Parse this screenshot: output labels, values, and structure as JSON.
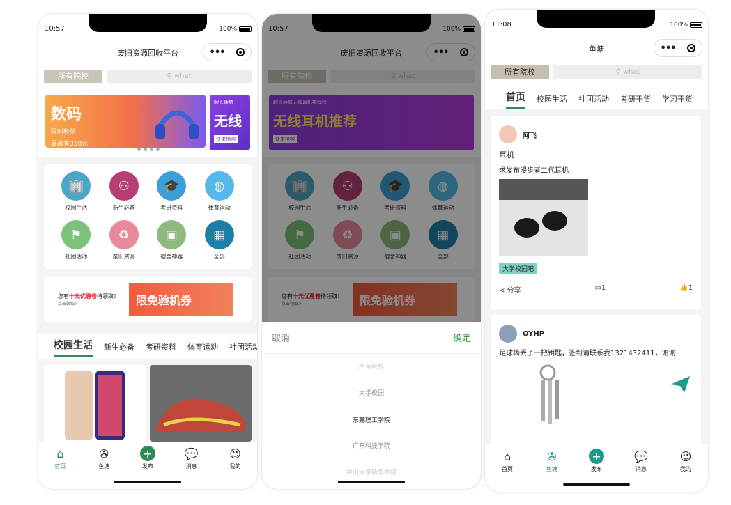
{
  "screen1": {
    "time": "10:57",
    "battery": "100%",
    "title": "废旧资源回收平台",
    "school_btn": "所有院校",
    "search_placeholder": "what",
    "banner_a_big": "数码",
    "banner_a_tag": "限时秒杀",
    "banner_a_small": "最高省350元",
    "banner_b_tiny": "超长续航",
    "banner_b_big": "无线",
    "banner_b_btn": "快来抢购",
    "categories": [
      {
        "label": "校园生活",
        "icon": "building-icon",
        "color": "#4aa7c7"
      },
      {
        "label": "新生必备",
        "icon": "people-icon",
        "color": "#b53e72"
      },
      {
        "label": "考研资料",
        "icon": "graduation-cap-icon",
        "color": "#3b9ed6"
      },
      {
        "label": "体育运动",
        "icon": "basketball-icon",
        "color": "#55b8e8"
      },
      {
        "label": "社团活动",
        "icon": "flag-icon",
        "color": "#7dc27a"
      },
      {
        "label": "废旧资源",
        "icon": "recycle-box-icon",
        "color": "#e88a9c"
      },
      {
        "label": "宿舍神器",
        "icon": "photo-icon",
        "color": "#8fb97f"
      },
      {
        "label": "全部",
        "icon": "grid-icon",
        "color": "#1f7ea8"
      }
    ],
    "coupon_line1_pre": "您有",
    "coupon_line1_hl": "十元优惠卷",
    "coupon_line1_post": "待领取！",
    "coupon_line2": "点击领取>",
    "coupon_banner": "限免验机券",
    "tabs": [
      "校园生活",
      "新生必备",
      "考研资料",
      "体育运动",
      "社团活动"
    ],
    "tabbar": [
      "首页",
      "鱼塘",
      "发布",
      "消息",
      "我的"
    ]
  },
  "screen2": {
    "time": "10:57",
    "battery": "100%",
    "title": "废旧资源回收平台",
    "school_btn": "所有院校",
    "search_placeholder": "what",
    "banner_tiny": "超长续航无线耳机推荐榜",
    "banner_big": "无线耳机推荐",
    "banner_btn": "快来抢购",
    "categories": [
      "校园生活",
      "新生必备",
      "考研资料",
      "体育运动",
      "社团活动",
      "废旧资源",
      "宿舍神器",
      "全部"
    ],
    "coupon_line1_pre": "您有",
    "coupon_line1_hl": "十元优惠卷",
    "coupon_line1_post": "待领取！",
    "coupon_line2": "点击领取>",
    "coupon_banner": "限免验机券",
    "picker": {
      "cancel": "取消",
      "ok": "确定",
      "options": [
        "所有院校",
        "大学校园",
        "东莞理工学院",
        "广东科技学院",
        "中山大学新华学院"
      ],
      "selected_index": 2
    }
  },
  "screen3": {
    "time": "11:08",
    "battery": "100%",
    "title": "鱼塘",
    "school_btn": "所有院校",
    "search_placeholder": "what",
    "tabs": [
      "首页",
      "校园生活",
      "社团活动",
      "考研干货",
      "学习干货"
    ],
    "post1": {
      "user": "阿飞",
      "title": "耳机",
      "body": "求发布漫步者二代耳机",
      "tag": "大学校园吧",
      "share": "分享",
      "comments": "1",
      "likes": "1"
    },
    "post2": {
      "user": "OYHP",
      "body": "足球场丢了一把钥匙，签到请联系我1321432411，谢谢"
    },
    "tabbar": [
      "首页",
      "鱼塘",
      "发布",
      "消息",
      "我的"
    ]
  }
}
